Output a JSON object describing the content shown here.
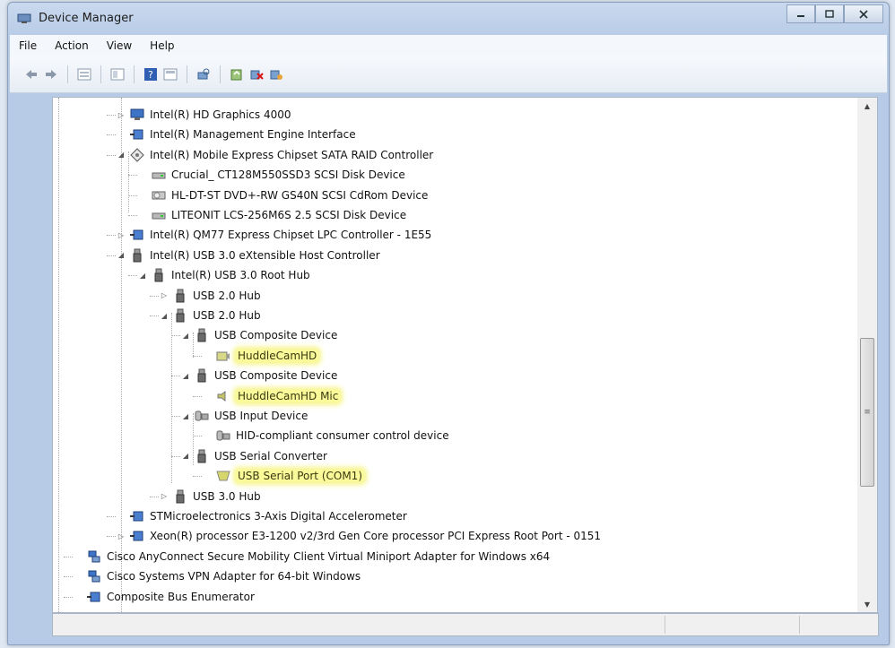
{
  "window": {
    "title": "Device Manager"
  },
  "menu": [
    "File",
    "Action",
    "View",
    "Help"
  ],
  "toolbar": [
    "back-icon",
    "forward-icon",
    "properties-icon",
    "view-icon",
    "help-icon",
    "show-icon",
    "scan-icon",
    "update-icon",
    "uninstall-icon",
    "disable-icon"
  ],
  "tree": [
    {
      "label": "Intel(R) HD Graphics 4000",
      "icon": "display-icon",
      "expander": "collapsed"
    },
    {
      "label": "Intel(R) Management Engine Interface",
      "icon": "device-icon",
      "expander": "none"
    },
    {
      "label": "Intel(R) Mobile Express Chipset SATA RAID Controller",
      "icon": "storage-controller-icon",
      "expander": "expanded"
    },
    {
      "label": "Crucial_ CT128M550SSD3 SCSI Disk Device",
      "icon": "disk-icon",
      "expander": "none"
    },
    {
      "label": "HL-DT-ST DVD+-RW GS40N SCSI CdRom Device",
      "icon": "cdrom-icon",
      "expander": "none"
    },
    {
      "label": "LITEONIT LCS-256M6S 2.5 SCSI Disk Device",
      "icon": "disk-icon",
      "expander": "none"
    },
    {
      "label": "Intel(R) QM77 Express Chipset LPC Controller - 1E55",
      "icon": "device-icon",
      "expander": "collapsed"
    },
    {
      "label": "Intel(R) USB 3.0 eXtensible Host Controller",
      "icon": "usb-icon",
      "expander": "expanded"
    },
    {
      "label": "Intel(R) USB 3.0 Root Hub",
      "icon": "usb-icon",
      "expander": "expanded"
    },
    {
      "label": "USB 2.0 Hub",
      "icon": "usb-icon",
      "expander": "collapsed"
    },
    {
      "label": "USB 2.0 Hub",
      "icon": "usb-icon",
      "expander": "expanded"
    },
    {
      "label": "USB Composite Device",
      "icon": "usb-icon",
      "expander": "expanded"
    },
    {
      "label": "HuddleCamHD",
      "icon": "camera-icon",
      "expander": "none",
      "highlight": true
    },
    {
      "label": "USB Composite Device",
      "icon": "usb-icon",
      "expander": "expanded"
    },
    {
      "label": "HuddleCamHD Mic",
      "icon": "speaker-icon",
      "expander": "none",
      "highlight": true
    },
    {
      "label": "USB Input Device",
      "icon": "hid-icon",
      "expander": "expanded"
    },
    {
      "label": "HID-compliant consumer control device",
      "icon": "hid-icon",
      "expander": "none"
    },
    {
      "label": "USB Serial Converter",
      "icon": "usb-icon",
      "expander": "expanded"
    },
    {
      "label": "USB Serial Port (COM1)",
      "icon": "port-icon",
      "expander": "none",
      "highlight": true
    },
    {
      "label": "USB 3.0 Hub",
      "icon": "usb-icon",
      "expander": "collapsed"
    },
    {
      "label": "STMicroelectronics 3-Axis Digital Accelerometer",
      "icon": "device-icon",
      "expander": "none"
    },
    {
      "label": "Xeon(R) processor E3-1200 v2/3rd Gen Core processor PCI Express Root Port - 0151",
      "icon": "device-icon",
      "expander": "collapsed"
    },
    {
      "label": "Cisco AnyConnect Secure Mobility Client Virtual Miniport Adapter for Windows x64",
      "icon": "network-adapter-icon",
      "expander": "none"
    },
    {
      "label": "Cisco Systems VPN Adapter for 64-bit Windows",
      "icon": "network-adapter-icon",
      "expander": "none"
    },
    {
      "label": "Composite Bus Enumerator",
      "icon": "device-icon",
      "expander": "none"
    }
  ],
  "colors": {
    "highlight": "#fbfa9a",
    "accent": "#2f5fb3"
  }
}
